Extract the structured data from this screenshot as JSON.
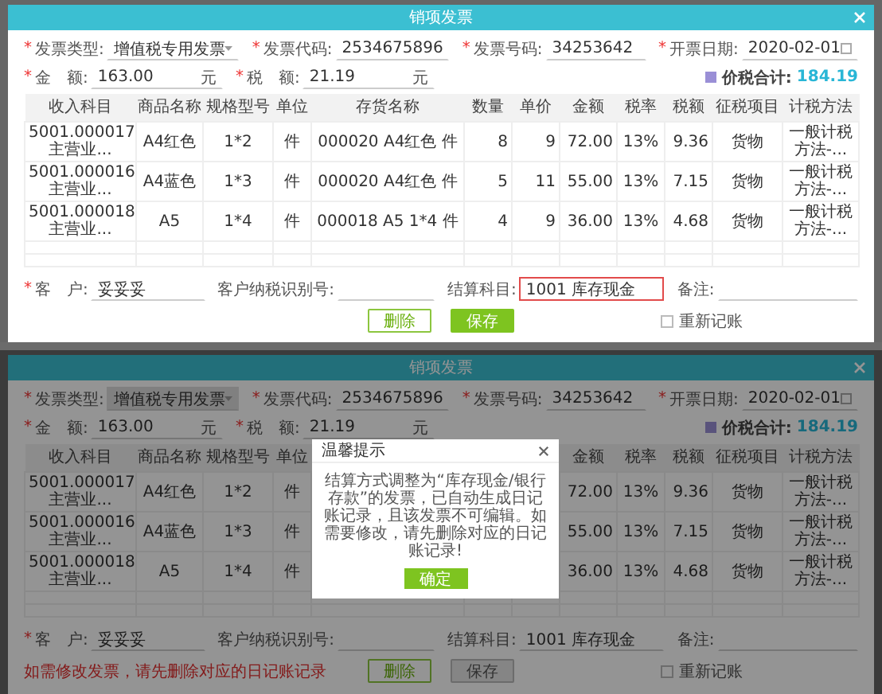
{
  "screens": [
    {
      "dimmed": false,
      "title": "销项发票",
      "top_fields": [
        {
          "label": "发票类型:",
          "value": "增值税专用发票",
          "required_mark": "*",
          "kind": "select",
          "disabled": false
        },
        {
          "label": "发票代码:",
          "value": "2534675896",
          "required_mark": "*",
          "kind": "text",
          "disabled": false
        },
        {
          "label": "发票号码:",
          "value": "34253642",
          "required_mark": "*",
          "kind": "text",
          "disabled": false
        },
        {
          "label": "开票日期:",
          "value": "2020-02-01",
          "required_mark": "*",
          "kind": "date",
          "disabled": false
        }
      ],
      "amount_fields": [
        {
          "label": "金　额:",
          "value": "163.00",
          "unit": "元",
          "required_mark": "*"
        },
        {
          "label": "税　额:",
          "value": "21.19",
          "unit": "元",
          "required_mark": "*"
        }
      ],
      "total": {
        "label": "价税合计:",
        "value": "184.19"
      },
      "columns": [
        "收入科目",
        "商品名称",
        "规格型号",
        "单位",
        "存货名称",
        "数量",
        "单价",
        "金额",
        "税率",
        "税额",
        "征税项目",
        "计税方法"
      ],
      "rows": [
        [
          "5001.000017 主营业...",
          "A4红色",
          "1*2",
          "件",
          "000020 A4红色 件",
          "8",
          "9",
          "72.00",
          "13%",
          "9.36",
          "货物",
          "一般计税方法-..."
        ],
        [
          "5001.000016 主营业...",
          "A4蓝色",
          "1*3",
          "件",
          "000020 A4红色 件",
          "5",
          "11",
          "55.00",
          "13%",
          "7.15",
          "货物",
          "一般计税方法-..."
        ],
        [
          "5001.000018 主营业...",
          "A5",
          "1*4",
          "件",
          "000018 A5 1*4 件",
          "4",
          "9",
          "36.00",
          "13%",
          "4.68",
          "货物",
          "一般计税方法-..."
        ]
      ],
      "footer_fields": [
        {
          "label": "客　户:",
          "value": "妥妥妥",
          "required_mark": "*",
          "highlighted": false
        },
        {
          "label": "客户纳税识别号:",
          "highlighted": false
        },
        {
          "label": "结算科目:",
          "value": "1001 库存现金",
          "highlighted": true
        },
        {
          "label": "备注:",
          "highlighted": false
        }
      ],
      "buttons": [
        {
          "label": "删除",
          "kind": "outline",
          "disabled": false
        },
        {
          "label": "保存",
          "kind": "solid",
          "disabled": false
        }
      ],
      "checkbox": {
        "label": "重新记账",
        "checked": false
      }
    },
    {
      "dimmed": true,
      "title": "销项发票",
      "top_fields": [
        {
          "label": "发票类型:",
          "value": "增值税专用发票",
          "required_mark": "*",
          "kind": "select",
          "disabled": true
        },
        {
          "label": "发票代码:",
          "value": "2534675896",
          "required_mark": "*",
          "kind": "text",
          "disabled": false
        },
        {
          "label": "发票号码:",
          "value": "34253642",
          "required_mark": "*",
          "kind": "text",
          "disabled": false
        },
        {
          "label": "开票日期:",
          "value": "2020-02-01",
          "required_mark": "*",
          "kind": "date",
          "disabled": false
        }
      ],
      "amount_fields": [
        {
          "label": "金　额:",
          "value": "163.00",
          "unit": "元",
          "required_mark": "*"
        },
        {
          "label": "税　额:",
          "value": "21.19",
          "unit": "元",
          "required_mark": "*"
        }
      ],
      "total": {
        "label": "价税合计:",
        "value": "184.19"
      },
      "columns": [
        "收入科目",
        "商品名称",
        "规格型号",
        "单位",
        null,
        null,
        null,
        "金额",
        "税率",
        "税额",
        "征税项目",
        "计税方法"
      ],
      "rows": [
        [
          "5001.000017 主营业...",
          "A4红色",
          "1*2",
          "件",
          null,
          null,
          null,
          "72.00",
          "13%",
          "9.36",
          "货物",
          "一般计税方法-..."
        ],
        [
          "5001.000016 主营业...",
          "A4蓝色",
          "1*3",
          "件",
          null,
          null,
          null,
          "55.00",
          "13%",
          "7.15",
          "货物",
          "一般计税方法-..."
        ],
        [
          "5001.000018 主营业...",
          "A5",
          "1*4",
          "件",
          null,
          null,
          null,
          "36.00",
          "13%",
          "4.68",
          "货物",
          "一般计税方法-..."
        ]
      ],
      "footer_fields": [
        {
          "label": "客　户:",
          "value": "妥妥妥",
          "required_mark": "*",
          "highlighted": false
        },
        {
          "label": "客户纳税识别号:",
          "highlighted": false
        },
        {
          "label": "结算科目:",
          "value": "1001 库存现金",
          "highlighted": false
        },
        {
          "label": "备注:",
          "highlighted": false
        }
      ],
      "note": "如需修改发票，请先删除对应的日记账记录",
      "buttons": [
        {
          "label": "删除",
          "kind": "outline",
          "disabled": false
        },
        {
          "label": "保存",
          "kind": "solid",
          "disabled": true
        }
      ],
      "checkbox": {
        "label": "重新记账",
        "checked": false
      },
      "dialog": {
        "title": "温馨提示",
        "message": "结算方式调整为“库存现金/银行存款”的发票，已自动生成日记账记录，且该发票不可编辑。如需要修改，请先删除对应的日记账记录!",
        "button": "确定"
      }
    }
  ]
}
